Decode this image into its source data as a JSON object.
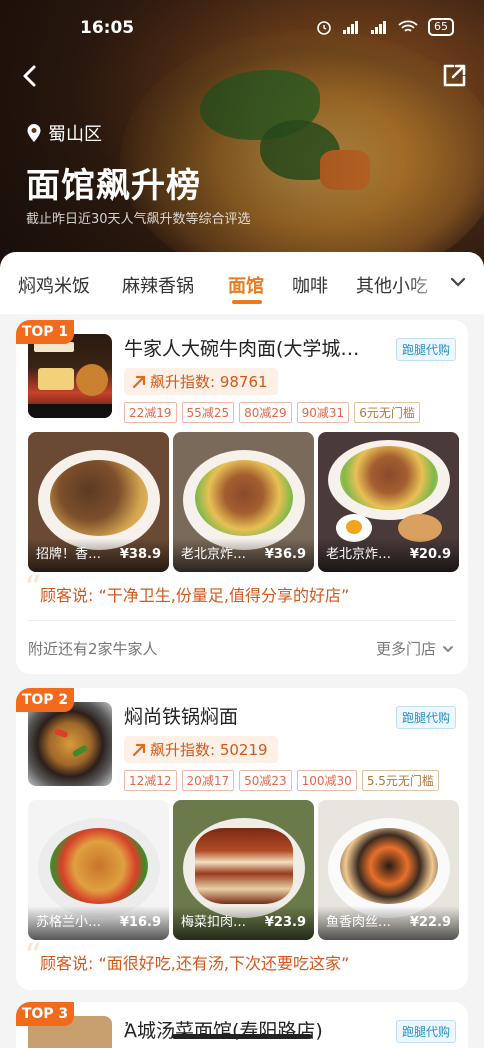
{
  "status": {
    "time": "16:05",
    "battery": "65"
  },
  "hero": {
    "location": "蜀山区",
    "title": "面馆飙升榜",
    "subtitle": "截止昨日近30天人气飙升数等综合评选"
  },
  "tabs": [
    "焖鸡米饭",
    "麻辣香锅",
    "面馆",
    "咖啡",
    "其他小吃"
  ],
  "active_tab": 2,
  "cards": [
    {
      "rank": "TOP 1",
      "name": "牛家人大碗牛肉面(大学城…",
      "delivery": "跑腿代购",
      "heat": "飙升指数: 98761",
      "coupons": [
        "22减19",
        "55减25",
        "80减29",
        "90减31",
        "6元无门槛"
      ],
      "dishes": [
        {
          "name": "招牌！香…",
          "price": "¥38.9"
        },
        {
          "name": "老北京炸…",
          "price": "¥36.9"
        },
        {
          "name": "老北京炸…",
          "price": "¥20.9"
        }
      ],
      "review": "顾客说: “干净卫生,份量足,值得分享的好店”",
      "nearby": "附近还有2家牛家人",
      "more": "更多门店"
    },
    {
      "rank": "TOP 2",
      "name": "焖尚铁锅焖面",
      "delivery": "跑腿代购",
      "heat": "飙升指数: 50219",
      "coupons": [
        "12减12",
        "20减17",
        "50减23",
        "100减30",
        "5.5元无门槛"
      ],
      "dishes": [
        {
          "name": "苏格兰小…",
          "price": "¥16.9"
        },
        {
          "name": "梅菜扣肉…",
          "price": "¥23.9"
        },
        {
          "name": "鱼香肉丝…",
          "price": "¥22.9"
        }
      ],
      "review": "顾客说: “面很好吃,还有汤,下次还要吃这家”"
    },
    {
      "rank": "TOP 3",
      "name": "Ἀ城汤菜面馆(寿阳路店)",
      "delivery": "跑腿代购"
    }
  ]
}
